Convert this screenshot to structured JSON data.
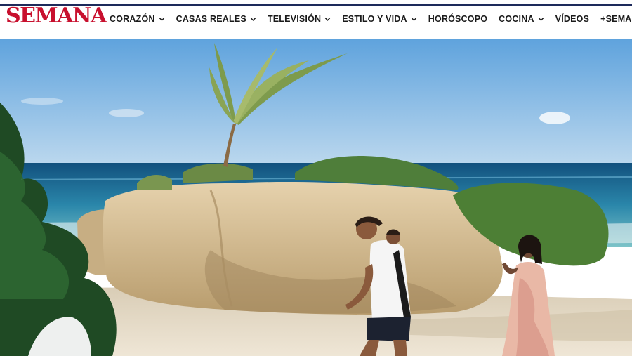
{
  "brand": {
    "name": "SEMANA",
    "color": "#c8102e",
    "rule_color": "#1d2a5b"
  },
  "nav": {
    "items": [
      {
        "label": "CORAZÓN",
        "has_dropdown": true
      },
      {
        "label": "CASAS REALES",
        "has_dropdown": true
      },
      {
        "label": "TELEVISIÓN",
        "has_dropdown": true
      },
      {
        "label": "ESTILO Y VIDA",
        "has_dropdown": true
      },
      {
        "label": "HORÓSCOPO",
        "has_dropdown": false
      },
      {
        "label": "COCINA",
        "has_dropdown": true
      },
      {
        "label": "VÍDEOS",
        "has_dropdown": false
      },
      {
        "label": "+SEMANA",
        "has_dropdown": true
      }
    ],
    "dropdown_icon": "chevron-down-icon"
  },
  "hero": {
    "scene": "beach photo with palm tree, rocks and two people walking",
    "colors": {
      "sky": "#8fc0e8",
      "sea": "#1f6d97",
      "sand": "#e9ddc8",
      "rock": "#d8c39c"
    }
  }
}
